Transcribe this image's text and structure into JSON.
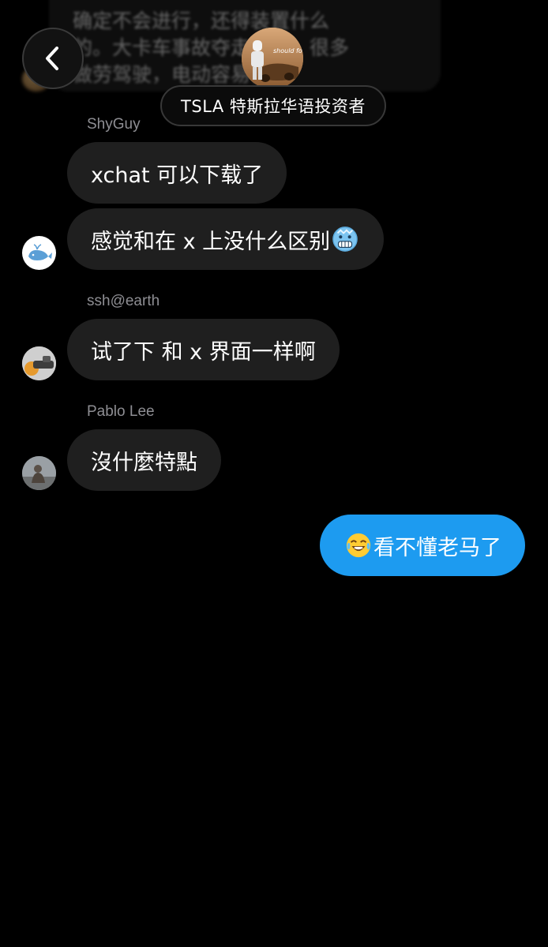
{
  "header": {
    "group_name": "TSLA 特斯拉华语投资者",
    "back_icon": "chevron-left-icon",
    "avatar_text": "should fo"
  },
  "previous_message": {
    "lines": [
      "确定不会进行，还得装置什么",
      "的。大卡车事故夺走人了，很多",
      "做劳驾驶，电动容易很多"
    ]
  },
  "messages": [
    {
      "sender": "ShyGuy",
      "text": "xchat 可以下载了",
      "avatar_icon": "whale-avatar"
    },
    {
      "sender": "",
      "text": "感觉和在 x 上没什么区别",
      "trailing_emoji": "freezing-face-emoji"
    },
    {
      "sender": "ssh@earth",
      "text": "试了下 和 x 界面一样啊",
      "avatar_icon": "user-avatar"
    },
    {
      "sender": "Pablo Lee",
      "text": "沒什麼特點",
      "avatar_icon": "user-avatar"
    },
    {
      "sender": "me",
      "text": "看不懂老马了",
      "leading_emoji": "tears-of-joy-emoji"
    }
  ],
  "colors": {
    "background": "#000000",
    "incoming_bubble": "#1f1f1f",
    "outgoing_bubble": "#1d9bf0",
    "sender_name": "#8e8e93"
  }
}
